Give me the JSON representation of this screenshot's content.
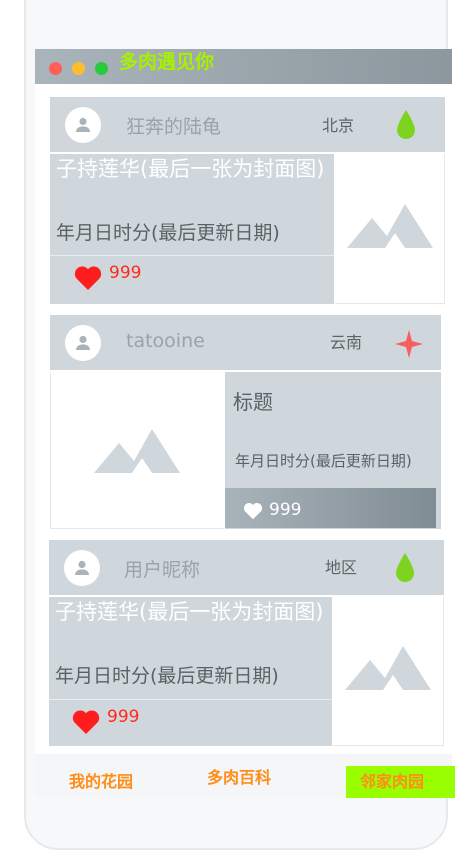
{
  "app": {
    "title": "多肉遇见你"
  },
  "posts": [
    {
      "username": "狂奔的陆龟",
      "region": "北京",
      "region_icon": "green-drop-icon",
      "title": "子持莲华(最后一张为封面图)",
      "date": "年月日时分(最后更新日期)",
      "likes": "999"
    },
    {
      "username": "tatooine",
      "region": "云南",
      "region_icon": "red-star-icon",
      "title": "标题",
      "date": "年月日时分(最后更新日期)",
      "likes": "999"
    },
    {
      "username": "用户昵称",
      "region": "地区",
      "region_icon": "green-drop-icon",
      "title": "子持莲华(最后一张为封面图)",
      "date": "年月日时分(最后更新日期)",
      "likes": "999"
    }
  ],
  "nav": {
    "items": [
      "我的花园",
      "多肉百科",
      "邻家肉园"
    ],
    "active_index": 2
  },
  "colors": {
    "accent_green": "#99ff00",
    "nav_text": "#ff8d18",
    "like_red": "#ff2a1a",
    "card_gray": "#cfd7dc"
  }
}
